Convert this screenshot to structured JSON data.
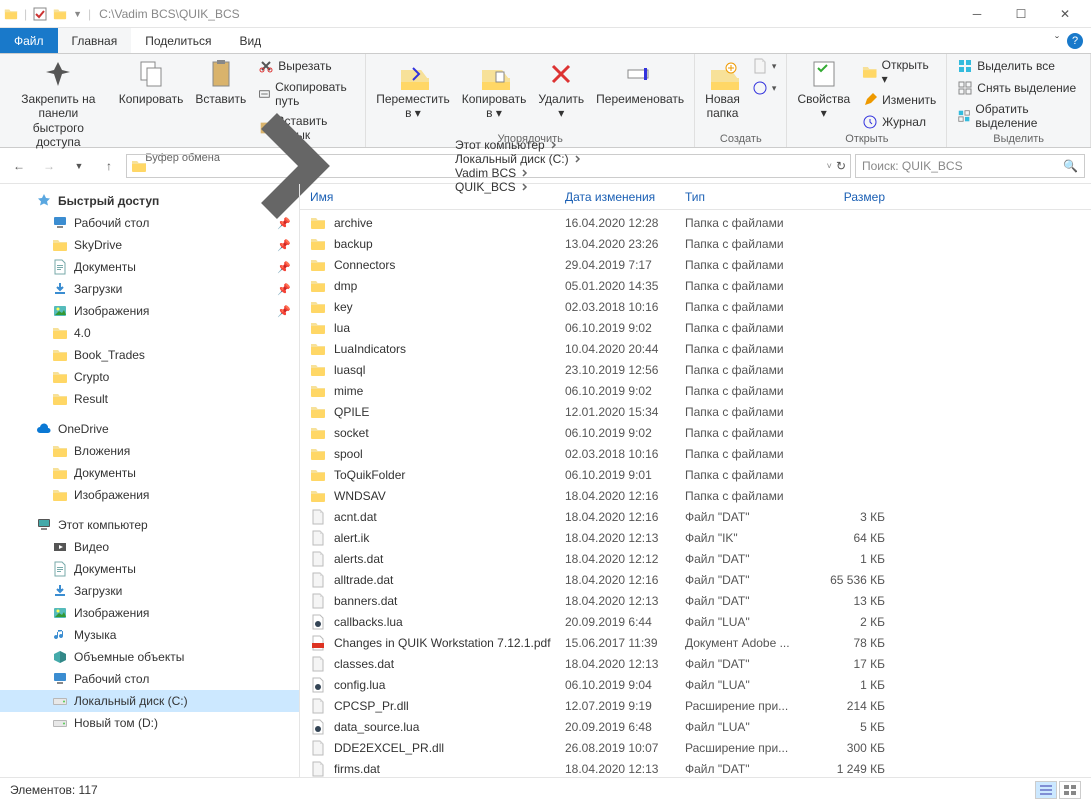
{
  "window": {
    "path": "C:\\Vadim BCS\\QUIK_BCS"
  },
  "tabs": {
    "file": "Файл",
    "home": "Главная",
    "share": "Поделиться",
    "view": "Вид"
  },
  "ribbon": {
    "pin": "Закрепить на панели\nбыстрого доступа",
    "copy": "Копировать",
    "paste": "Вставить",
    "cut": "Вырезать",
    "copypath": "Скопировать путь",
    "pasteshortcut": "Вставить ярлык",
    "g_clipboard": "Буфер обмена",
    "moveto": "Переместить\nв ▾",
    "copyto": "Копировать\nв ▾",
    "delete": "Удалить\n▾",
    "rename": "Переименовать",
    "g_organize": "Упорядочить",
    "newfolder": "Новая\nпапка",
    "g_create": "Создать",
    "properties": "Свойства\n▾",
    "open": "Открыть ▾",
    "edit": "Изменить",
    "history": "Журнал",
    "g_open": "Открыть",
    "selectall": "Выделить все",
    "selectnone": "Снять выделение",
    "invertsel": "Обратить выделение",
    "g_select": "Выделить"
  },
  "breadcrumbs": [
    "Этот компьютер",
    "Локальный диск (C:)",
    "Vadim BCS",
    "QUIK_BCS"
  ],
  "search_placeholder": "Поиск: QUIK_BCS",
  "sidebar": [
    {
      "indent": 1,
      "arrow": "",
      "icon": "star",
      "label": "Быстрый доступ",
      "bold": true
    },
    {
      "indent": 2,
      "arrow": "",
      "icon": "monitor",
      "label": "Рабочий стол",
      "pinned": true
    },
    {
      "indent": 2,
      "arrow": "",
      "icon": "folder",
      "label": "SkyDrive",
      "pinned": true
    },
    {
      "indent": 2,
      "arrow": "",
      "icon": "doc",
      "label": "Документы",
      "pinned": true
    },
    {
      "indent": 2,
      "arrow": "",
      "icon": "download",
      "label": "Загрузки",
      "pinned": true
    },
    {
      "indent": 2,
      "arrow": "",
      "icon": "image",
      "label": "Изображения",
      "pinned": true
    },
    {
      "indent": 2,
      "arrow": "",
      "icon": "folder",
      "label": "4.0"
    },
    {
      "indent": 2,
      "arrow": "",
      "icon": "folder",
      "label": "Book_Trades"
    },
    {
      "indent": 2,
      "arrow": "",
      "icon": "folder",
      "label": "Crypto"
    },
    {
      "indent": 2,
      "arrow": "",
      "icon": "folder",
      "label": "Result"
    },
    {
      "indent": 0,
      "arrow": "",
      "icon": "",
      "label": ""
    },
    {
      "indent": 1,
      "arrow": "",
      "icon": "cloud",
      "label": "OneDrive"
    },
    {
      "indent": 2,
      "arrow": "",
      "icon": "folder",
      "label": "Вложения"
    },
    {
      "indent": 2,
      "arrow": "",
      "icon": "folder",
      "label": "Документы"
    },
    {
      "indent": 2,
      "arrow": "",
      "icon": "folder",
      "label": "Изображения"
    },
    {
      "indent": 0,
      "arrow": "",
      "icon": "",
      "label": ""
    },
    {
      "indent": 1,
      "arrow": "",
      "icon": "pc",
      "label": "Этот компьютер"
    },
    {
      "indent": 2,
      "arrow": "",
      "icon": "video",
      "label": "Видео"
    },
    {
      "indent": 2,
      "arrow": "",
      "icon": "doc",
      "label": "Документы"
    },
    {
      "indent": 2,
      "arrow": "",
      "icon": "download",
      "label": "Загрузки"
    },
    {
      "indent": 2,
      "arrow": "",
      "icon": "image",
      "label": "Изображения"
    },
    {
      "indent": 2,
      "arrow": "",
      "icon": "music",
      "label": "Музыка"
    },
    {
      "indent": 2,
      "arrow": "",
      "icon": "cube",
      "label": "Объемные объекты"
    },
    {
      "indent": 2,
      "arrow": "",
      "icon": "monitor",
      "label": "Рабочий стол"
    },
    {
      "indent": 2,
      "arrow": "",
      "icon": "drive",
      "label": "Локальный диск (C:)",
      "selected": true
    },
    {
      "indent": 2,
      "arrow": "",
      "icon": "drive",
      "label": "Новый том (D:)"
    }
  ],
  "columns": {
    "name": "Имя",
    "date": "Дата изменения",
    "type": "Тип",
    "size": "Размер"
  },
  "files": [
    {
      "icon": "folder",
      "name": "archive",
      "date": "16.04.2020 12:28",
      "type": "Папка с файлами",
      "size": ""
    },
    {
      "icon": "folder",
      "name": "backup",
      "date": "13.04.2020 23:26",
      "type": "Папка с файлами",
      "size": ""
    },
    {
      "icon": "folder",
      "name": "Connectors",
      "date": "29.04.2019 7:17",
      "type": "Папка с файлами",
      "size": ""
    },
    {
      "icon": "folder",
      "name": "dmp",
      "date": "05.01.2020 14:35",
      "type": "Папка с файлами",
      "size": ""
    },
    {
      "icon": "folder",
      "name": "key",
      "date": "02.03.2018 10:16",
      "type": "Папка с файлами",
      "size": ""
    },
    {
      "icon": "folder",
      "name": "lua",
      "date": "06.10.2019 9:02",
      "type": "Папка с файлами",
      "size": ""
    },
    {
      "icon": "folder",
      "name": "LuaIndicators",
      "date": "10.04.2020 20:44",
      "type": "Папка с файлами",
      "size": ""
    },
    {
      "icon": "folder",
      "name": "luasql",
      "date": "23.10.2019 12:56",
      "type": "Папка с файлами",
      "size": ""
    },
    {
      "icon": "folder",
      "name": "mime",
      "date": "06.10.2019 9:02",
      "type": "Папка с файлами",
      "size": ""
    },
    {
      "icon": "folder",
      "name": "QPILE",
      "date": "12.01.2020 15:34",
      "type": "Папка с файлами",
      "size": ""
    },
    {
      "icon": "folder",
      "name": "socket",
      "date": "06.10.2019 9:02",
      "type": "Папка с файлами",
      "size": ""
    },
    {
      "icon": "folder",
      "name": "spool",
      "date": "02.03.2018 10:16",
      "type": "Папка с файлами",
      "size": ""
    },
    {
      "icon": "folder",
      "name": "ToQuikFolder",
      "date": "06.10.2019 9:01",
      "type": "Папка с файлами",
      "size": ""
    },
    {
      "icon": "folder",
      "name": "WNDSAV",
      "date": "18.04.2020 12:16",
      "type": "Папка с файлами",
      "size": ""
    },
    {
      "icon": "file",
      "name": "acnt.dat",
      "date": "18.04.2020 12:16",
      "type": "Файл \"DAT\"",
      "size": "3 КБ"
    },
    {
      "icon": "file",
      "name": "alert.ik",
      "date": "18.04.2020 12:13",
      "type": "Файл \"IK\"",
      "size": "64 КБ"
    },
    {
      "icon": "file",
      "name": "alerts.dat",
      "date": "18.04.2020 12:12",
      "type": "Файл \"DAT\"",
      "size": "1 КБ"
    },
    {
      "icon": "file",
      "name": "alltrade.dat",
      "date": "18.04.2020 12:16",
      "type": "Файл \"DAT\"",
      "size": "65 536 КБ"
    },
    {
      "icon": "file",
      "name": "banners.dat",
      "date": "18.04.2020 12:13",
      "type": "Файл \"DAT\"",
      "size": "13 КБ"
    },
    {
      "icon": "lua",
      "name": "callbacks.lua",
      "date": "20.09.2019 6:44",
      "type": "Файл \"LUA\"",
      "size": "2 КБ"
    },
    {
      "icon": "pdf",
      "name": "Changes in QUIK Workstation 7.12.1.pdf",
      "date": "15.06.2017 11:39",
      "type": "Документ Adobe ...",
      "size": "78 КБ"
    },
    {
      "icon": "file",
      "name": "classes.dat",
      "date": "18.04.2020 12:13",
      "type": "Файл \"DAT\"",
      "size": "17 КБ"
    },
    {
      "icon": "lua",
      "name": "config.lua",
      "date": "06.10.2019 9:04",
      "type": "Файл \"LUA\"",
      "size": "1 КБ"
    },
    {
      "icon": "file",
      "name": "CPCSP_Pr.dll",
      "date": "12.07.2019 9:19",
      "type": "Расширение при...",
      "size": "214 КБ"
    },
    {
      "icon": "lua",
      "name": "data_source.lua",
      "date": "20.09.2019 6:48",
      "type": "Файл \"LUA\"",
      "size": "5 КБ"
    },
    {
      "icon": "file",
      "name": "DDE2EXCEL_PR.dll",
      "date": "26.08.2019 10:07",
      "type": "Расширение при...",
      "size": "300 КБ"
    },
    {
      "icon": "file",
      "name": "firms.dat",
      "date": "18.04.2020 12:13",
      "type": "Файл \"DAT\"",
      "size": "1 249 КБ"
    }
  ],
  "status": "Элементов: 117"
}
